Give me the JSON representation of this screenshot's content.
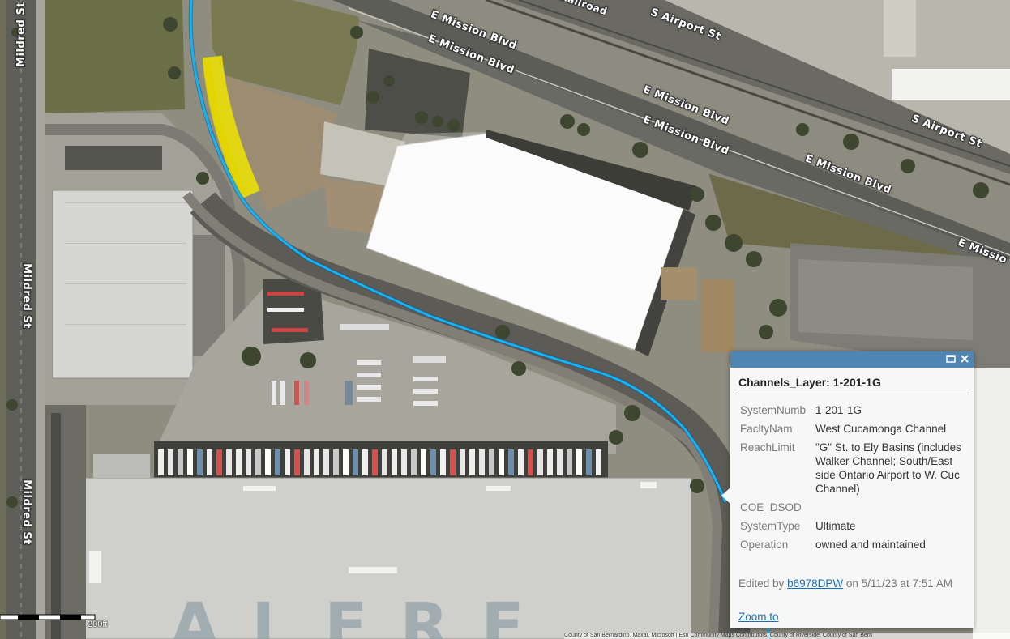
{
  "streets": {
    "mildred_1": "Mildred St",
    "mildred_2": "Mildred St",
    "mildred_3": "Mildred St",
    "mission_1": "E Mission Blvd",
    "mission_2": "E Mission Blvd",
    "mission_3": "E Mission Blvd",
    "mission_4": "E Mission Blvd",
    "mission_5": "E Mission Blvd",
    "mission_6": "E Missio",
    "airport_1": "S Airport St",
    "airport_2": "S Airport St",
    "railroad": "Railroad"
  },
  "building_text": "ALERE",
  "channel_color": "#14b4f0",
  "highlight_color": "#f2e600",
  "popup": {
    "title": "Channels_Layer: 1-201-1G",
    "header_color": "#4f85b3",
    "maximize_icon": "maximize-icon",
    "close_icon": "close-icon",
    "fields": [
      {
        "key": "SystemNumb",
        "value": "1-201-1G"
      },
      {
        "key": "FacltyNam",
        "value": "West Cucamonga Channel"
      },
      {
        "key": "ReachLimit",
        "value": "\"G\" St. to Ely Basins (includes Walker Channel; South/East side Ontario Airport to W. Cuc Channel)"
      },
      {
        "key": "COE_DSOD",
        "value": ""
      },
      {
        "key": "SystemType",
        "value": "Ultimate"
      },
      {
        "key": "Operation",
        "value": "owned and maintained"
      }
    ],
    "edited_prefix": "Edited by",
    "edited_user": "b6978DPW",
    "edited_suffix": "on 5/11/23 at 7:51 AM",
    "zoom_label": "Zoom to"
  },
  "scale": {
    "label": "200ft"
  },
  "attribution": "County of San Bernardino, Maxar, Microsoft | Esri Community Maps Contributors, County of Riverside, County of San Bern"
}
